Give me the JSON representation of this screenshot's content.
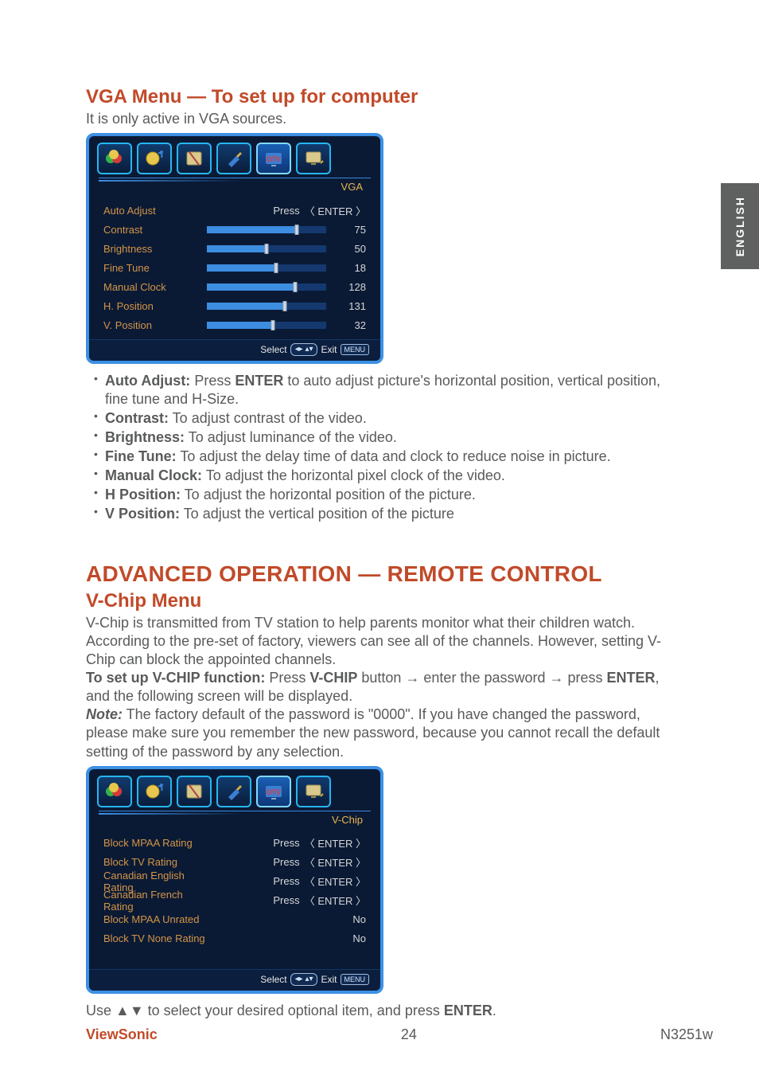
{
  "sideTab": "ENGLISH",
  "vga": {
    "title": "VGA Menu — To set up for computer",
    "subtitle": "It is only active in VGA sources.",
    "osd": {
      "title": "VGA",
      "footerSelect": "Select",
      "footerExit": "Exit",
      "footerMenu": "MENU",
      "rows": [
        {
          "label": "Auto Adjust",
          "type": "press",
          "press": "Press",
          "value": "ENTER"
        },
        {
          "label": "Contrast",
          "type": "slider",
          "value": "75",
          "pct": 75
        },
        {
          "label": "Brightness",
          "type": "slider",
          "value": "50",
          "pct": 50
        },
        {
          "label": "Fine Tune",
          "type": "slider",
          "value": "18",
          "pct": 58
        },
        {
          "label": "Manual Clock",
          "type": "slider",
          "value": "128",
          "pct": 74
        },
        {
          "label": "H. Position",
          "type": "slider",
          "value": "131",
          "pct": 65
        },
        {
          "label": "V. Position",
          "type": "slider",
          "value": "32",
          "pct": 55
        }
      ]
    },
    "bullets": [
      {
        "lead": "Auto Adjust:",
        "rest": " Press ",
        "strong": "ENTER",
        "rest2": " to auto adjust picture's horizontal position, vertical position, fine tune and H-Size."
      },
      {
        "lead": "Contrast:",
        "rest": " To adjust contrast of the video.",
        "strong": "",
        "rest2": ""
      },
      {
        "lead": "Brightness:",
        "rest": " To adjust luminance of the video.",
        "strong": "",
        "rest2": ""
      },
      {
        "lead": "Fine Tune:",
        "rest": " To adjust the delay time of data and clock to reduce noise in picture.",
        "strong": "",
        "rest2": ""
      },
      {
        "lead": "Manual Clock:",
        "rest": " To adjust the horizontal pixel clock of the video.",
        "strong": "",
        "rest2": ""
      },
      {
        "lead": "H Position:",
        "rest": " To adjust the horizontal position of the picture.",
        "strong": "",
        "rest2": ""
      },
      {
        "lead": "V Position:",
        "rest": " To adjust the vertical position of the picture",
        "strong": "",
        "rest2": ""
      }
    ]
  },
  "adv": {
    "bigTitle": "ADVANCED OPERATION — REMOTE CONTROL",
    "subTitle": "V-Chip Menu",
    "para1": "V-Chip is transmitted from TV station to help parents monitor what their children watch. According to the pre-set of factory, viewers can see all of the channels. However, setting V-Chip can block the appointed channels.",
    "setupLead": "To set up V-CHIP function:",
    "setupMid": " Press ",
    "setupStrong1": "V-CHIP",
    "setupMid2": " button → enter the password → press ",
    "setupStrong2": "ENTER",
    "setupEnd": ", and the following screen will be displayed.",
    "noteLead": "Note:",
    "noteRest": " The factory default of the password is \"0000\". If you have changed the password, please make sure you remember the new password, because you cannot recall the default setting of the password by any selection.",
    "osd": {
      "title": "V-Chip",
      "footerSelect": "Select",
      "footerExit": "Exit",
      "footerMenu": "MENU",
      "rows": [
        {
          "label": "Block MPAA Rating",
          "type": "press",
          "press": "Press",
          "value": "ENTER"
        },
        {
          "label": "Block TV Rating",
          "type": "press",
          "press": "Press",
          "value": "ENTER"
        },
        {
          "label": "Canadian English Rating",
          "type": "press",
          "press": "Press",
          "value": "ENTER"
        },
        {
          "label": "Canadian French Rating",
          "type": "press",
          "press": "Press",
          "value": "ENTER"
        },
        {
          "label": "Block MPAA Unrated",
          "type": "value",
          "value": "No"
        },
        {
          "label": "Block TV None Rating",
          "type": "value",
          "value": "No"
        }
      ]
    },
    "afterOsd1": "Use ▲▼ to select your desired optional item, and press ",
    "afterOsdStrong": "ENTER",
    "afterOsdEnd": "."
  },
  "footer": {
    "vs": "ViewSonic",
    "page": "24",
    "model": "N3251w"
  }
}
